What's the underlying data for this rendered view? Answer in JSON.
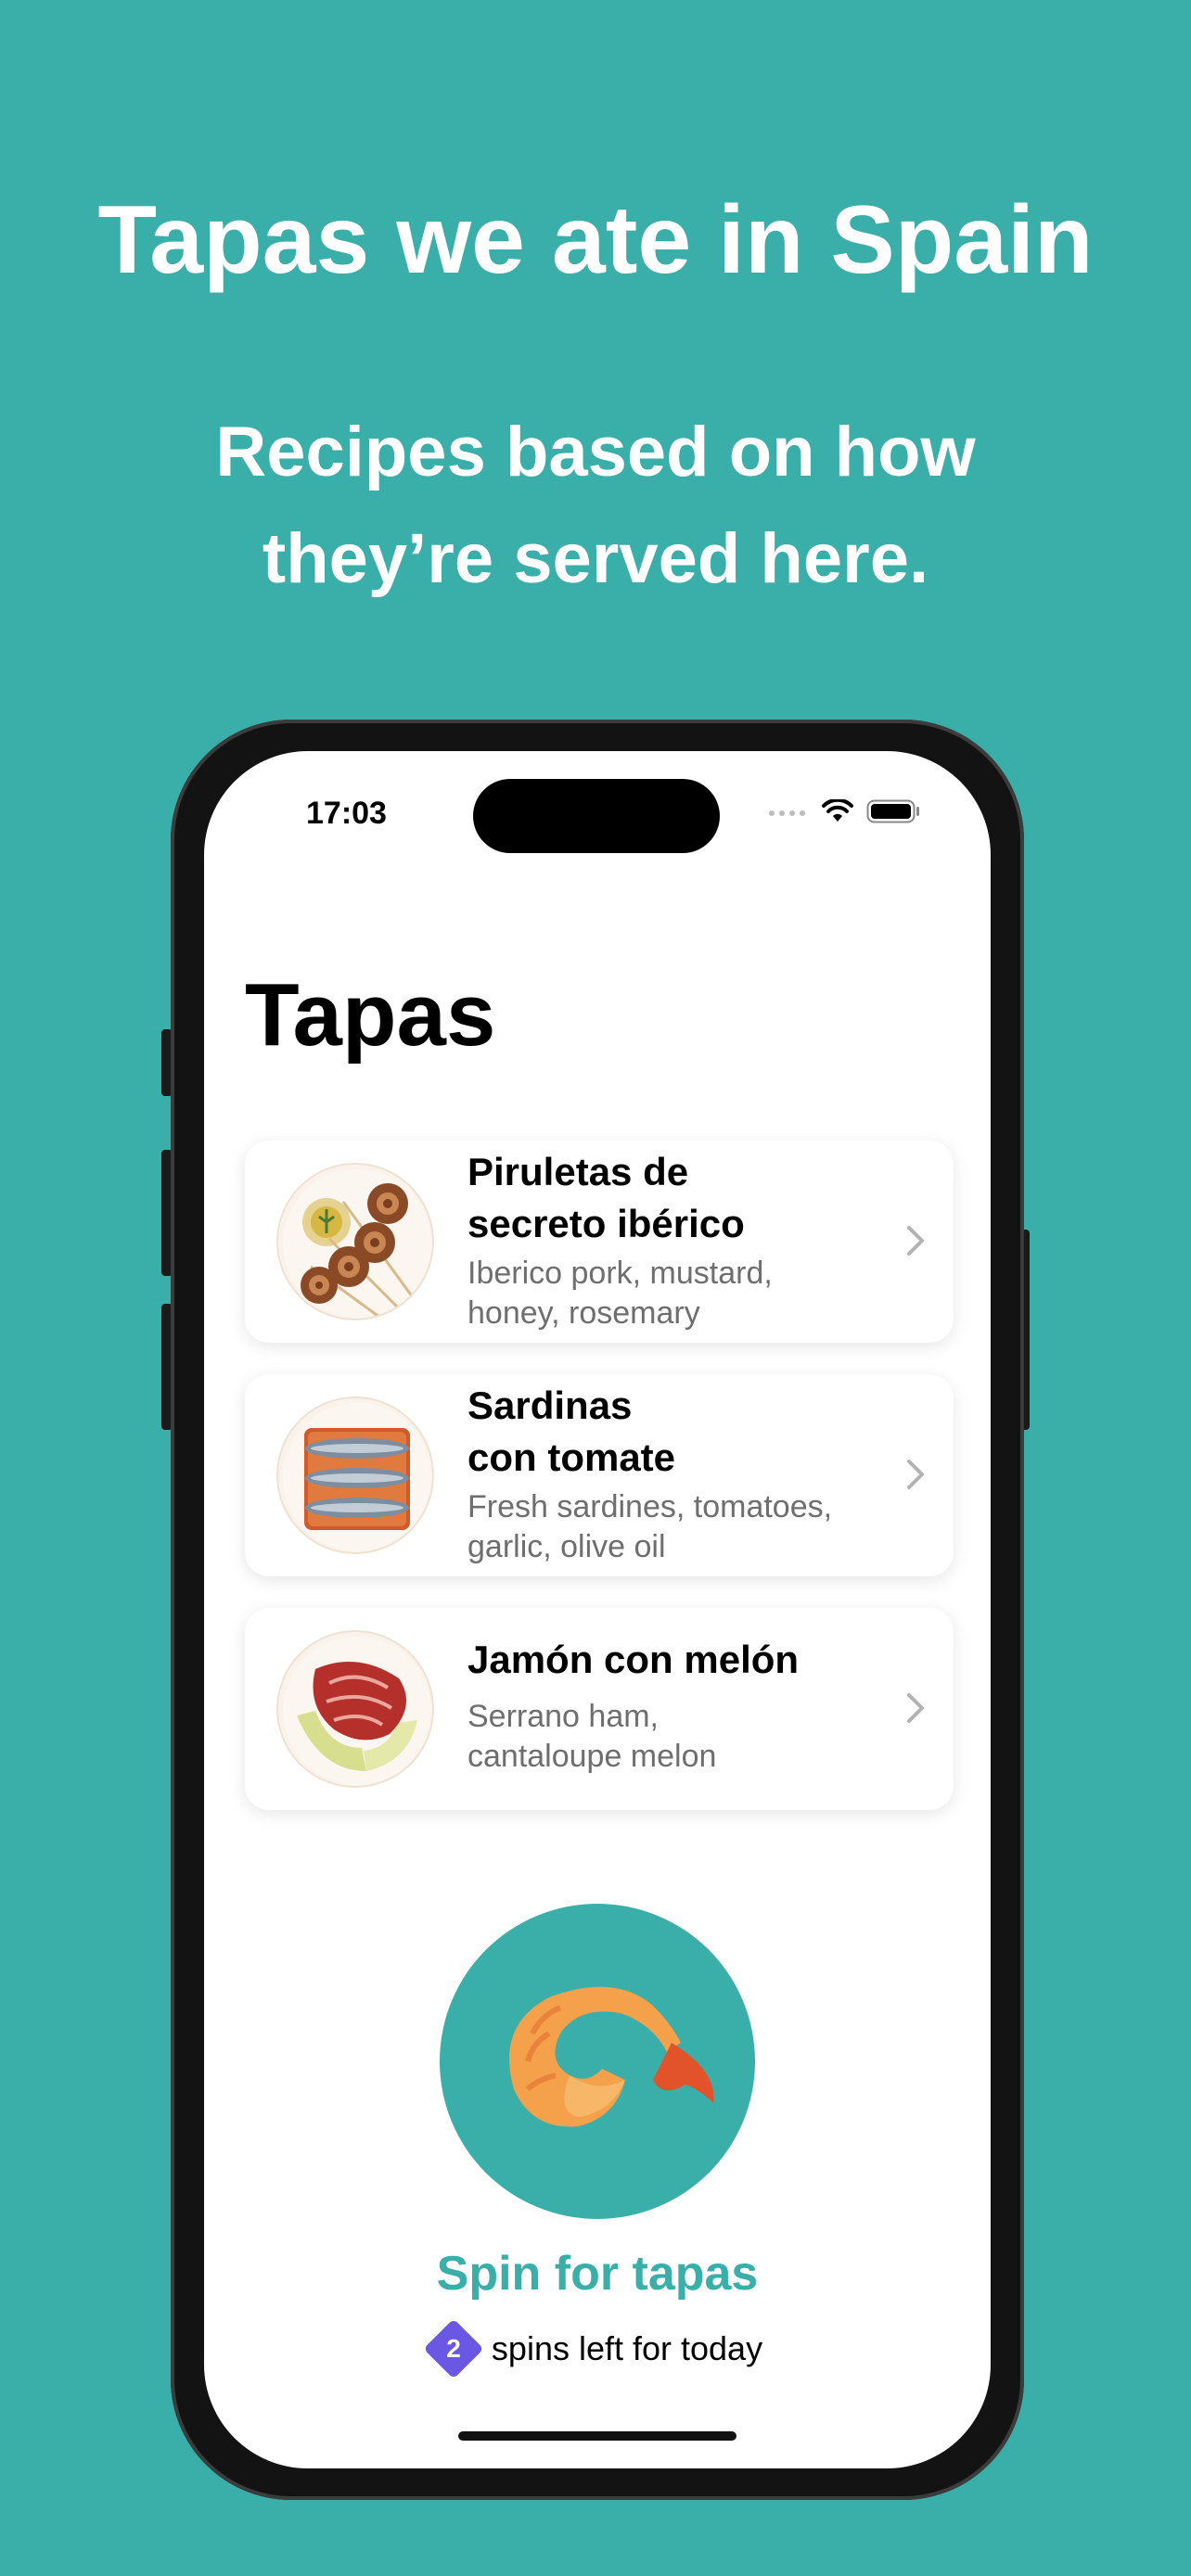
{
  "header": {
    "headline": "Tapas we ate in Spain",
    "subline_1": "Recipes based on how",
    "subline_2": "they’re served here."
  },
  "status_bar": {
    "time": "17:03",
    "icons": [
      "signal-icon",
      "wifi-icon",
      "battery-icon"
    ]
  },
  "nav": {
    "title": "Tapas"
  },
  "recipes": [
    {
      "title_1": "Piruletas de",
      "title_2": "secreto ibérico",
      "sub_1": "Iberico pork, mustard,",
      "sub_2": "honey, rosemary",
      "icon": "pork-skewers-image"
    },
    {
      "title_1": "Sardinas",
      "title_2": "con tomate",
      "sub_1": "Fresh sardines, tomatoes,",
      "sub_2": "garlic, olive oil",
      "icon": "sardines-image"
    },
    {
      "title_1": "Jamón con melón",
      "sub_1": "Serrano ham,",
      "sub_2": "cantaloupe melon",
      "icon": "ham-melon-image"
    }
  ],
  "spin": {
    "label": "Spin for tapas",
    "icon": "shrimp-icon",
    "count": "2",
    "spins_text": "spins left for today"
  },
  "colors": {
    "teal": "#3aaea8",
    "badge_purple": "#6a57e3"
  }
}
